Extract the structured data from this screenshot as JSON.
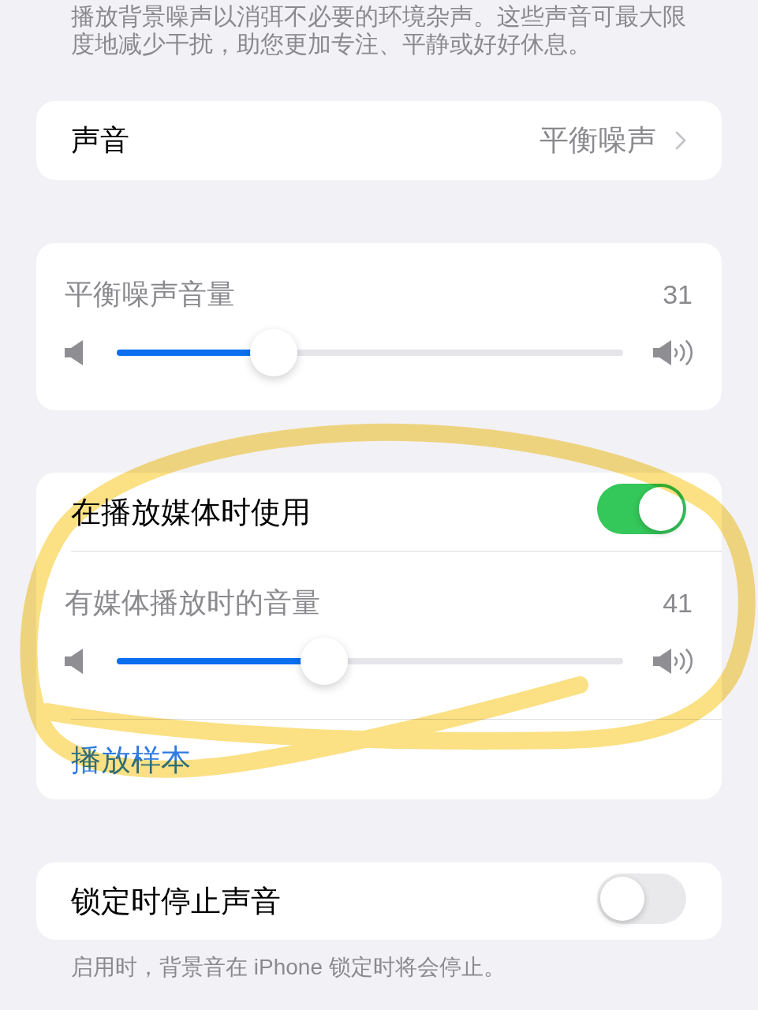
{
  "description": "播放背景噪声以消弭不必要的环境杂声。这些声音可最大限度地减少干扰，助您更加专注、平静或好好休息。",
  "groups": [
    {
      "rows": [
        {
          "kind": "link",
          "label": "声音",
          "value": "平衡噪声"
        }
      ]
    },
    {
      "rows": [
        {
          "kind": "slider",
          "label": "平衡噪声音量",
          "reading": "31",
          "level": 0.31
        }
      ]
    },
    {
      "rows": [
        {
          "kind": "toggle",
          "label": "在播放媒体时使用",
          "on": true
        },
        {
          "kind": "slider",
          "label": "有媒体播放时的音量",
          "reading": "41",
          "level": 0.41
        },
        {
          "kind": "action",
          "label": "播放样本"
        }
      ]
    },
    {
      "rows": [
        {
          "kind": "toggle",
          "label": "锁定时停止声音",
          "on": false
        }
      ],
      "footer": "启用时，背景音在 iPhone 锁定时将会停止。"
    }
  ]
}
